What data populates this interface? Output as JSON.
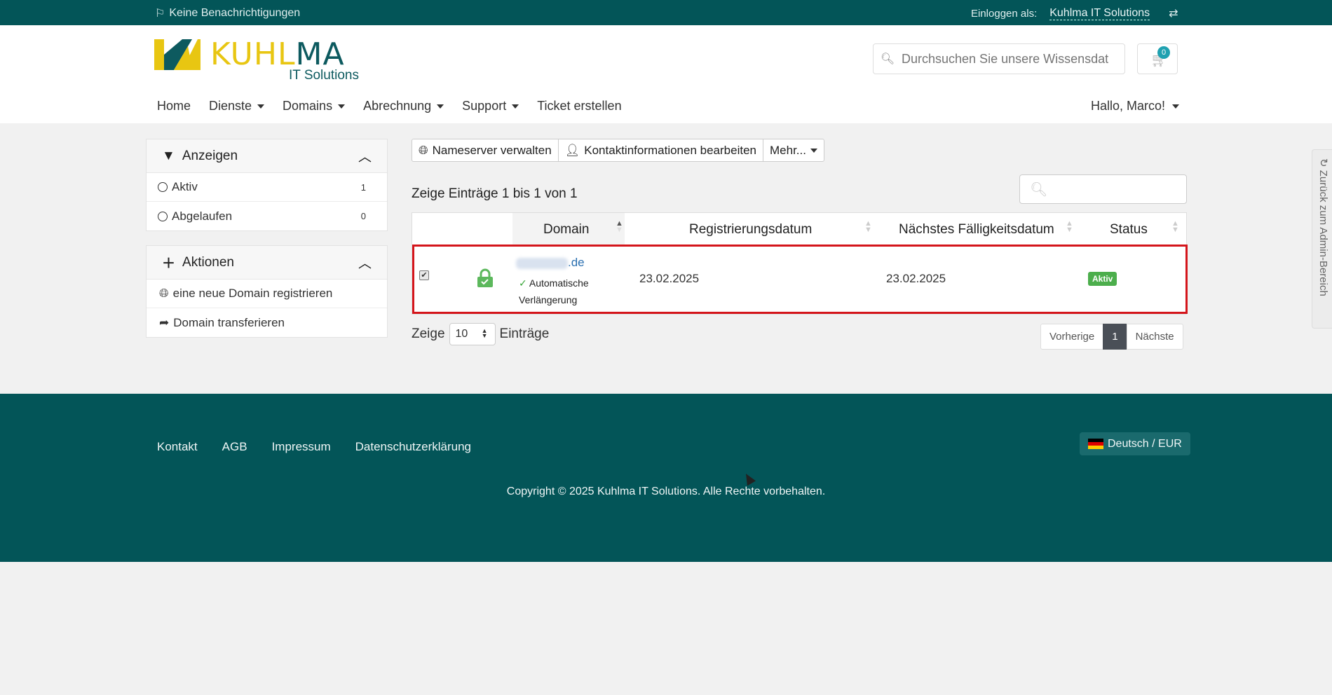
{
  "topbar": {
    "notifications": "Keine Benachrichtigungen",
    "login_label": "Einloggen als:",
    "login_user": "Kuhlma IT Solutions"
  },
  "logo": {
    "part1": "KUHL",
    "part2": "MA",
    "subtitle": "IT Solutions"
  },
  "search": {
    "placeholder": "Durchsuchen Sie unsere Wissensdat"
  },
  "cart": {
    "count": "0"
  },
  "nav": {
    "items": [
      {
        "label": "Home",
        "dropdown": false
      },
      {
        "label": "Dienste",
        "dropdown": true
      },
      {
        "label": "Domains",
        "dropdown": true
      },
      {
        "label": "Abrechnung",
        "dropdown": true
      },
      {
        "label": "Support",
        "dropdown": true
      },
      {
        "label": "Ticket erstellen",
        "dropdown": false
      }
    ],
    "greeting": "Hallo, Marco!"
  },
  "sidebar": {
    "filter": {
      "title": "Anzeigen",
      "items": [
        {
          "label": "Aktiv",
          "count": "1"
        },
        {
          "label": "Abgelaufen",
          "count": "0"
        }
      ]
    },
    "actions": {
      "title": "Aktionen",
      "items": [
        {
          "label": "eine neue Domain registrieren",
          "icon": "globe-icon"
        },
        {
          "label": "Domain transferieren",
          "icon": "share-icon"
        }
      ]
    }
  },
  "toolbar": {
    "nameserver": "Nameserver verwalten",
    "contact": "Kontaktinformationen bearbeiten",
    "more": "Mehr..."
  },
  "table": {
    "info": "Zeige Einträge 1 bis 1 von 1",
    "columns": [
      "Domain",
      "Registrierungsdatum",
      "Nächstes Fälligkeitsdatum",
      "Status"
    ],
    "rows": [
      {
        "domain_suffix": ".de",
        "autorenew": "Automatische Verlängerung",
        "registered": "23.02.2025",
        "due": "23.02.2025",
        "status": "Aktiv",
        "checked": true
      }
    ]
  },
  "length": {
    "prefix": "Zeige",
    "value": "10",
    "suffix": "Einträge"
  },
  "pager": {
    "prev": "Vorherige",
    "current": "1",
    "next": "Nächste"
  },
  "footer": {
    "links": [
      "Kontakt",
      "AGB",
      "Impressum",
      "Datenschutzerklärung"
    ],
    "language": "Deutsch / EUR",
    "copyright": "Copyright © 2025 Kuhlma IT Solutions. Alle Rechte vorbehalten."
  },
  "admin_tab": "Zurück zum Admin-Bereich",
  "colors": {
    "brand_teal": "#035558",
    "brand_yellow": "#e8c612",
    "status_green": "#4cae4c",
    "highlight_red": "#d4151b"
  }
}
